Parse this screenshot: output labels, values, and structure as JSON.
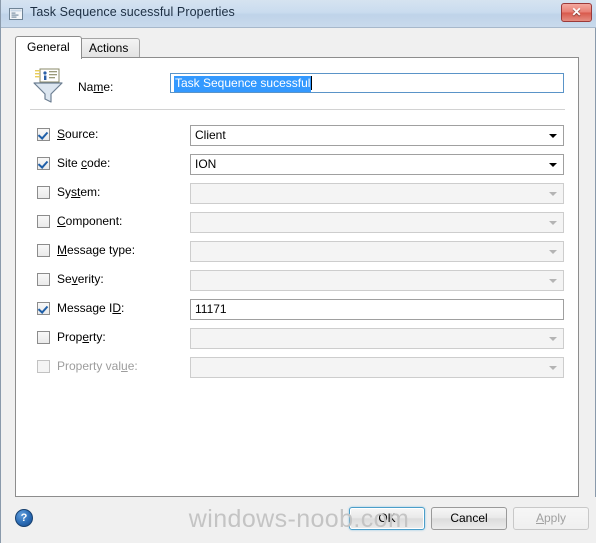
{
  "window": {
    "title": "Task Sequence sucessful Properties",
    "icon": "window-document-icon",
    "close_label": "✕"
  },
  "tabs": [
    {
      "label": "General",
      "active": true
    },
    {
      "label": "Actions",
      "active": false
    }
  ],
  "general": {
    "header_icon": "filter-funnel-icon",
    "name_label": "Name:",
    "name_value": "Task Sequence sucessful",
    "name_selected": true,
    "rows": [
      {
        "label": "Source:",
        "accel": "S",
        "checked": true,
        "enabled": true,
        "type": "combo",
        "value": "Client"
      },
      {
        "label": "Site code:",
        "accel": "c",
        "checked": true,
        "enabled": true,
        "type": "combo",
        "value": "ION"
      },
      {
        "label": "System:",
        "accel": "st",
        "checked": false,
        "enabled": true,
        "type": "combo",
        "value": ""
      },
      {
        "label": "Component:",
        "accel": "C",
        "checked": false,
        "enabled": true,
        "type": "combo",
        "value": ""
      },
      {
        "label": "Message type:",
        "accel": "M",
        "checked": false,
        "enabled": true,
        "type": "combo",
        "value": ""
      },
      {
        "label": "Severity:",
        "accel": "v",
        "checked": false,
        "enabled": true,
        "type": "combo",
        "value": ""
      },
      {
        "label": "Message ID:",
        "accel": "D",
        "checked": true,
        "enabled": true,
        "type": "text",
        "value": "11171"
      },
      {
        "label": "Property:",
        "accel": "e",
        "checked": false,
        "enabled": true,
        "type": "combo",
        "value": ""
      },
      {
        "label": "Property value:",
        "accel": "u",
        "checked": false,
        "enabled": false,
        "type": "combo",
        "value": ""
      }
    ]
  },
  "footer": {
    "help_icon": "help-question-icon",
    "help_glyph": "?",
    "watermark": "windows-noob.com",
    "ok_label": "OK",
    "cancel_label": "Cancel",
    "apply_label": "Apply"
  }
}
